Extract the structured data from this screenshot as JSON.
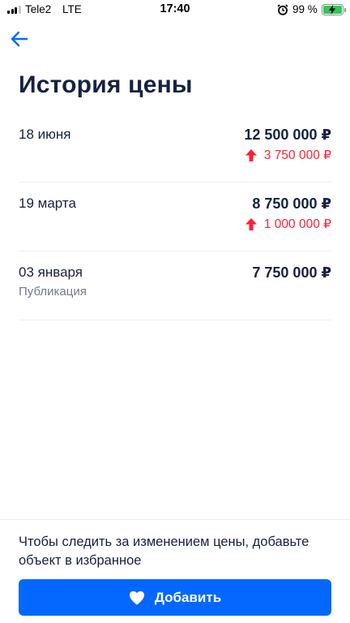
{
  "status_bar": {
    "carrier": "Tele2",
    "network": "LTE",
    "time": "17:40",
    "battery_percent": "99 %",
    "signal_bars_active": 3,
    "icons": [
      "signal-icon",
      "alarm-icon",
      "battery-charging-icon"
    ]
  },
  "header": {
    "back_icon": "arrow-left-icon",
    "title": "История цены"
  },
  "history": [
    {
      "date": "18 июня",
      "price": "12 500 000 ₽",
      "change": "3 750 000 ₽",
      "change_direction": "up",
      "subtitle": ""
    },
    {
      "date": "19 марта",
      "price": "8 750 000 ₽",
      "change": "1 000 000 ₽",
      "change_direction": "up",
      "subtitle": ""
    },
    {
      "date": "03 января",
      "price": "7 750 000 ₽",
      "change": "",
      "change_direction": "",
      "subtitle": "Публикация"
    }
  ],
  "footer": {
    "hint": "Чтобы следить за изменением цены, добавьте объект в избранное",
    "add_button_label": "Добавить",
    "add_button_icon": "heart-icon"
  },
  "colors": {
    "accent": "#0468ff",
    "text_primary": "#152242",
    "text_secondary": "#737a8e",
    "price_increase": "#ff1f34",
    "battery": "#34c759"
  }
}
